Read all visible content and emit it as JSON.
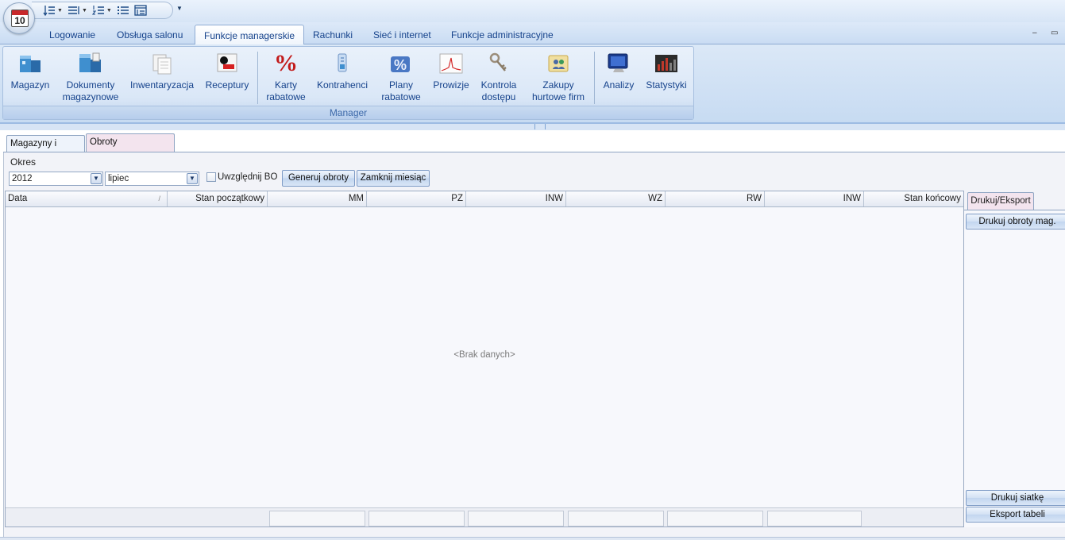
{
  "app": {
    "orb_day": "10",
    "orb_icon": "calendar-icon"
  },
  "quick_access": [
    {
      "icon": "sort-list-icon",
      "has_caret": true
    },
    {
      "icon": "align-list-icon",
      "has_caret": true
    },
    {
      "icon": "numbered-list-icon",
      "has_caret": true
    },
    {
      "icon": "bullet-list-icon",
      "has_caret": false
    },
    {
      "icon": "window-list-icon",
      "has_caret": false
    }
  ],
  "ribbon_tabs": [
    "Logowanie",
    "Obsługa salonu",
    "Funkcje managerskie",
    "Rachunki",
    "Sieć i internet",
    "Funkcje administracyjne"
  ],
  "active_ribbon_tab": "Funkcje managerskie",
  "ribbon_group": {
    "label": "Manager",
    "buttons": [
      {
        "line1": "Magazyn",
        "line2": "",
        "icon": "warehouse-icon"
      },
      {
        "line1": "Dokumenty",
        "line2": "magazynowe",
        "icon": "documents-warehouse-icon"
      },
      {
        "line1": "Inwentaryzacja",
        "line2": "",
        "icon": "inventory-icon"
      },
      {
        "line1": "Receptury",
        "line2": "",
        "icon": "recipes-icon"
      },
      {
        "line1": "Karty",
        "line2": "rabatowe",
        "icon": "percent-icon"
      },
      {
        "line1": "Kontrahenci",
        "line2": "",
        "icon": "contractors-icon"
      },
      {
        "line1": "Plany",
        "line2": "rabatowe",
        "icon": "discount-plans-icon"
      },
      {
        "line1": "Prowizje",
        "line2": "",
        "icon": "commission-chart-icon"
      },
      {
        "line1": "Kontrola",
        "line2": "dostępu",
        "icon": "keys-icon"
      },
      {
        "line1": "Zakupy",
        "line2": "hurtowe firm",
        "icon": "wholesale-icon"
      },
      {
        "line1": "Analizy",
        "line2": "",
        "icon": "monitor-icon"
      },
      {
        "line1": "Statystyki",
        "line2": "",
        "icon": "statistics-icon"
      }
    ]
  },
  "page_tabs": [
    "Magazyny i towary",
    "Obroty magazynowe"
  ],
  "active_page_tab": "Obroty magazynowe",
  "filters": {
    "okres_label": "Okres",
    "year": "2012",
    "month": "lipiec",
    "include_bo_label": "Uwzględnij BO",
    "include_bo_checked": false,
    "generate_label": "Generuj obroty",
    "close_month_label": "Zamknij miesiąc"
  },
  "grid": {
    "columns": [
      "Data",
      "Stan początkowy",
      "MM",
      "PZ",
      "INW",
      "WZ",
      "RW",
      "INW",
      "Stan końcowy"
    ],
    "rows": [],
    "empty_text": "<Brak danych>"
  },
  "side_panel": {
    "tab_label": "Drukuj/Eksport",
    "print_turnover": "Drukuj obroty mag.",
    "print_grid": "Drukuj siatkę",
    "export_table": "Eksport tabeli"
  },
  "colors": {
    "ribbon_text": "#15428b",
    "active_tab_pink": "#f3e4ee",
    "percent_red": "#c21b1b"
  }
}
